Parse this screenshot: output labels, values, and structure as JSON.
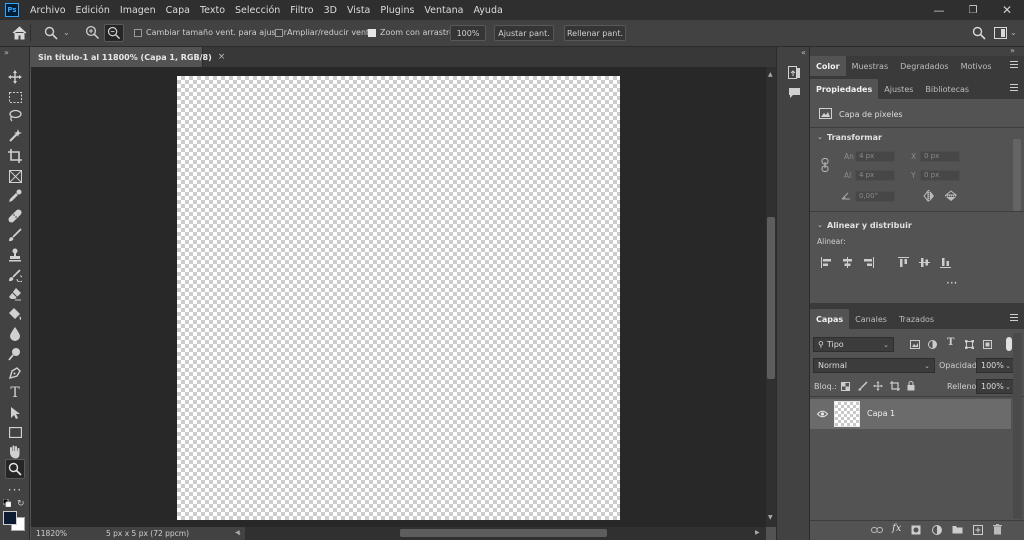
{
  "menubar": {
    "logo": "Ps",
    "items": [
      "Archivo",
      "Edición",
      "Imagen",
      "Capa",
      "Texto",
      "Selección",
      "Filtro",
      "3D",
      "Vista",
      "Plugins",
      "Ventana",
      "Ayuda"
    ]
  },
  "options": {
    "resize_windows": "Cambiar tamaño vent. para ajustar",
    "zoom_all": "Ampliar/reducir vent.",
    "scrubby": "Zoom con arrastre",
    "zoom_value": "100%",
    "fit_screen": "Ajustar pant.",
    "fill_screen": "Rellenar pant."
  },
  "document": {
    "tab_title": "Sin título-1 al 11800% (Capa 1, RGB/8)",
    "zoom": "11820%",
    "info": "5 px x 5 px (72 ppcm)"
  },
  "panels": {
    "top_tabs": [
      "Color",
      "Muestras",
      "Degradados",
      "Motivos"
    ],
    "mid_tabs": [
      "Propiedades",
      "Ajustes",
      "Bibliotecas"
    ],
    "layer_type": "Capa de píxeles",
    "transform_title": "Transformar",
    "an_label": "An",
    "al_label": "Al",
    "x_label": "X",
    "y_label": "Y",
    "width": "4 px",
    "height": "4 px",
    "x": "0 px",
    "y": "0 px",
    "angle": "0,00°",
    "align_title": "Alinear y distribuir",
    "align_label": "Alinear:",
    "layer_tabs": [
      "Capas",
      "Canales",
      "Trazados"
    ],
    "filter_kind": "Tipo",
    "blend_mode": "Normal",
    "opacity_label": "Opacidad:",
    "opacity": "100%",
    "lock_label": "Bloq.:",
    "fill_label": "Relleno:",
    "fill": "100%",
    "layers": [
      {
        "name": "Capa 1"
      }
    ]
  },
  "colors": {
    "foreground": "#0d1b33",
    "background": "#ffffff",
    "accent": "#31a8ff"
  }
}
